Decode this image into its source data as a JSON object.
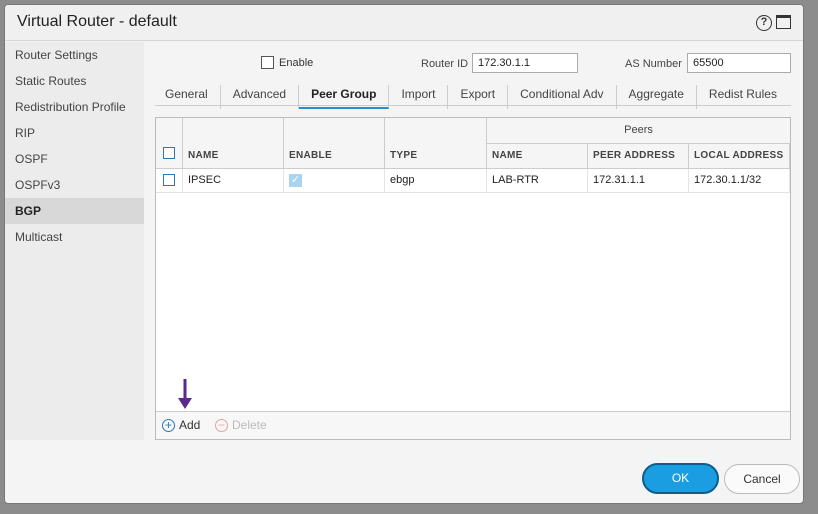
{
  "dialog": {
    "title": "Virtual Router - default",
    "help_icon_glyph": "?"
  },
  "sidebar": {
    "items": [
      {
        "label": "Router Settings"
      },
      {
        "label": "Static Routes"
      },
      {
        "label": "Redistribution Profile"
      },
      {
        "label": "RIP"
      },
      {
        "label": "OSPF"
      },
      {
        "label": "OSPFv3"
      },
      {
        "label": "BGP",
        "active": true
      },
      {
        "label": "Multicast"
      }
    ]
  },
  "bgp": {
    "enable_label": "Enable",
    "enable_checked": false,
    "router_id_label": "Router ID",
    "router_id_value": "172.30.1.1",
    "as_number_label": "AS Number",
    "as_number_value": "65500"
  },
  "tabs": [
    {
      "label": "General"
    },
    {
      "label": "Advanced"
    },
    {
      "label": "Peer Group",
      "active": true
    },
    {
      "label": "Import"
    },
    {
      "label": "Export"
    },
    {
      "label": "Conditional Adv"
    },
    {
      "label": "Aggregate"
    },
    {
      "label": "Redist Rules"
    }
  ],
  "grid": {
    "group_header": "Peers",
    "columns": {
      "name": "NAME",
      "enable": "ENABLE",
      "type": "TYPE",
      "peer_name": "NAME",
      "peer_address": "PEER ADDRESS",
      "local_address": "LOCAL ADDRESS"
    },
    "rows": [
      {
        "name": "IPSEC",
        "enabled": true,
        "type": "ebgp",
        "peer_name": "LAB-RTR",
        "peer_address": "172.31.1.1",
        "local_address": "172.30.1.1/32"
      }
    ],
    "add_label": "Add",
    "delete_label": "Delete"
  },
  "footer": {
    "ok_label": "OK",
    "cancel_label": "Cancel"
  },
  "colors": {
    "accent": "#1b9de2",
    "arrow": "#5b2a8c",
    "checkbox_blue": "#2a78b8"
  }
}
